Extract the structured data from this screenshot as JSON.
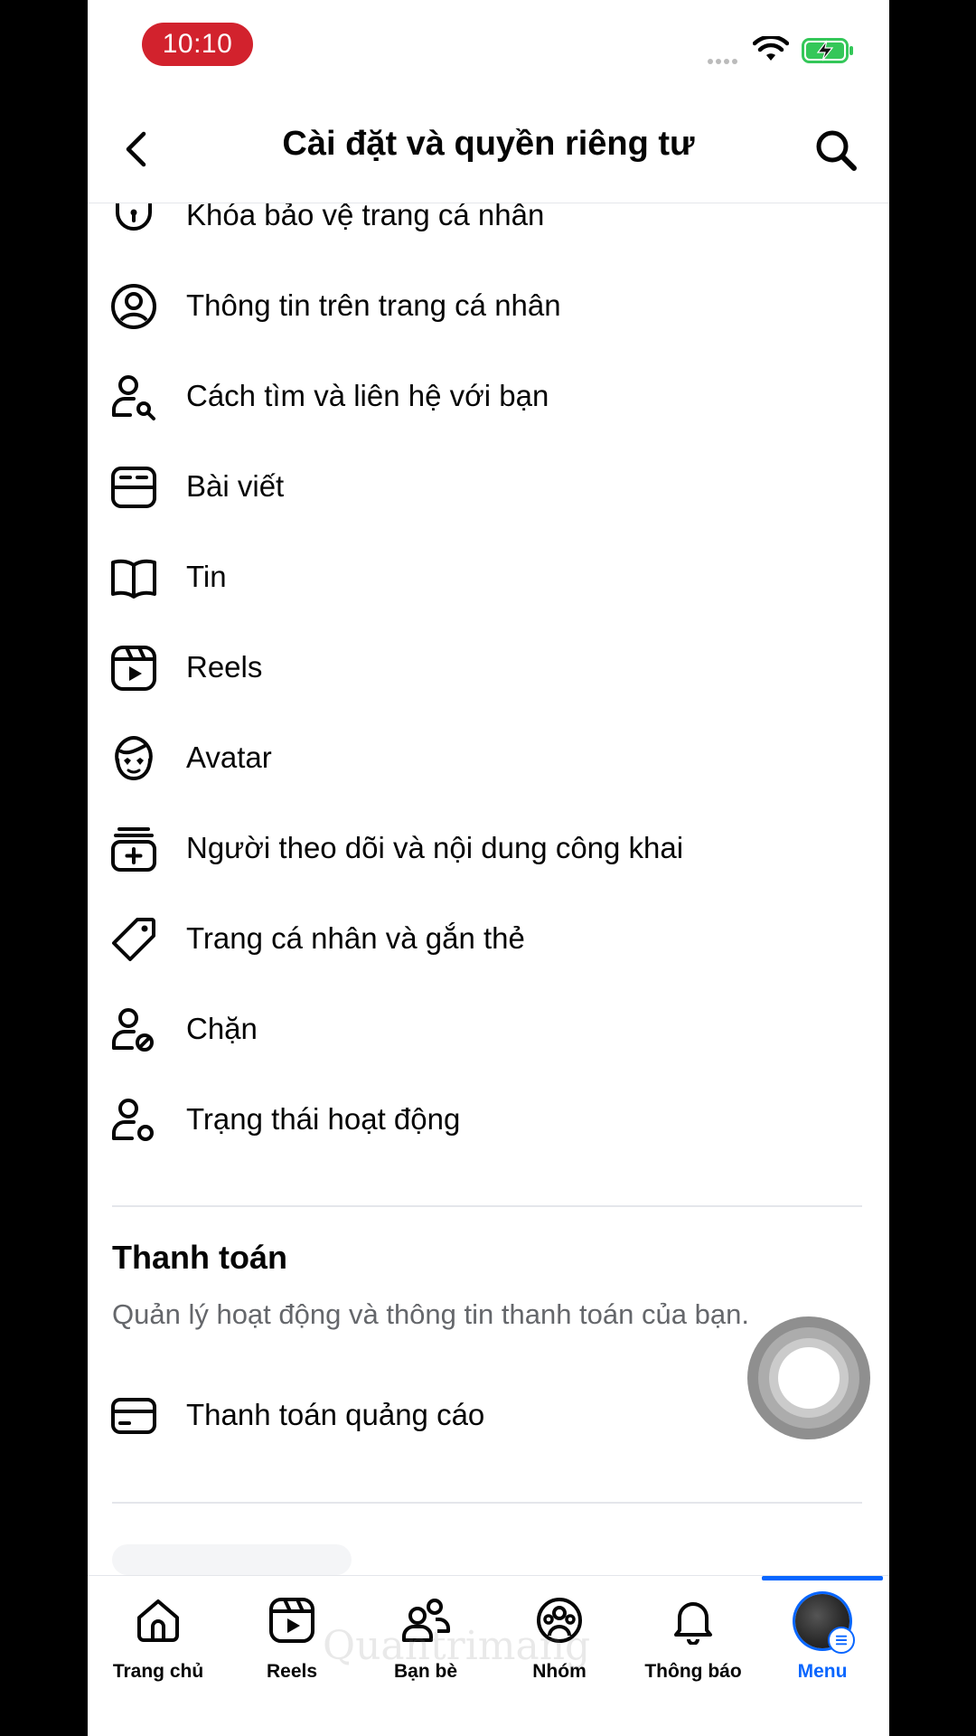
{
  "status_bar": {
    "time": "10:10"
  },
  "header": {
    "title": "Cài đặt và quyền riêng tư"
  },
  "privacy_items": [
    {
      "label": "Khóa bảo vệ trang cá nhân",
      "icon": "shield-lock-icon"
    },
    {
      "label": "Thông tin trên trang cá nhân",
      "icon": "user-circle-icon"
    },
    {
      "label": "Cách tìm và liên hệ với bạn",
      "icon": "user-search-icon"
    },
    {
      "label": "Bài viết",
      "icon": "post-card-icon"
    },
    {
      "label": "Tin",
      "icon": "open-book-icon"
    },
    {
      "label": "Reels",
      "icon": "reels-icon"
    },
    {
      "label": "Avatar",
      "icon": "avatar-face-icon"
    },
    {
      "label": "Người theo dõi và nội dung công khai",
      "icon": "add-box-icon"
    },
    {
      "label": "Trang cá nhân và gắn thẻ",
      "icon": "tag-icon"
    },
    {
      "label": "Chặn",
      "icon": "user-block-icon"
    },
    {
      "label": "Trạng thái hoạt động",
      "icon": "user-status-icon"
    }
  ],
  "payments": {
    "title": "Thanh toán",
    "description": "Quản lý hoạt động và thông tin thanh toán của bạn.",
    "item": {
      "label": "Thanh toán quảng cáo",
      "icon": "credit-card-icon"
    }
  },
  "bottom_nav": [
    {
      "label": "Trang chủ",
      "icon": "home-icon"
    },
    {
      "label": "Reels",
      "icon": "reels-icon"
    },
    {
      "label": "Bạn bè",
      "icon": "friends-icon"
    },
    {
      "label": "Nhóm",
      "icon": "groups-icon"
    },
    {
      "label": "Thông báo",
      "icon": "bell-icon"
    },
    {
      "label": "Menu",
      "icon": "avatar-menu-icon",
      "active": true
    }
  ],
  "colors": {
    "accent": "#0866ff",
    "time_pill": "#d2222d",
    "battery": "#34c759"
  },
  "watermark": "Quantrimang"
}
